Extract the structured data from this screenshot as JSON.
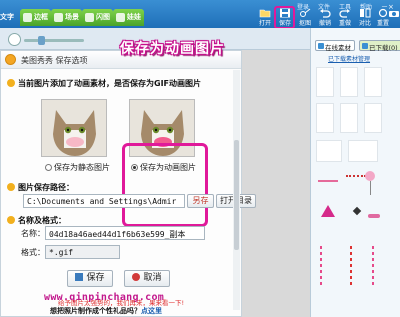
{
  "toolbar": {
    "left_fragment": "文字",
    "tabs": [
      {
        "label": "边框",
        "color": "#5bbd32"
      },
      {
        "label": "场景",
        "color": "#5bbd32"
      },
      {
        "label": "闪图",
        "color": "#5bbd32"
      },
      {
        "label": "娃娃",
        "color": "#5bbd32"
      }
    ],
    "menu": [
      "登录",
      "文件",
      "工具",
      "帮助"
    ],
    "buttons": [
      {
        "label": "打开",
        "icon": "folder-icon"
      },
      {
        "label": "保存",
        "icon": "save-icon"
      },
      {
        "label": "抠图",
        "icon": "cutout-icon"
      },
      {
        "label": "撤销",
        "icon": "undo-icon"
      },
      {
        "label": "重做",
        "icon": "redo-icon"
      },
      {
        "label": "对比",
        "icon": "compare-icon"
      },
      {
        "label": "重置",
        "icon": "reset-icon"
      },
      {
        "label": "修图",
        "icon": "camera-icon"
      }
    ]
  },
  "annotation": "保存为动画图片",
  "dialog": {
    "title": "美图秀秀  保存选项",
    "question": "当前图片添加了动画素材，是否保存为GIF动画图片",
    "options": [
      {
        "label": "保存为静态图片",
        "selected": false
      },
      {
        "label": "保存为动画图片",
        "selected": true
      }
    ],
    "path_section": "图片保存路径：",
    "path_value": "C:\\Documents and Settings\\Admir",
    "btn_save_as": "另存",
    "btn_open_dir": "打开目录",
    "name_section": "名称及格式：",
    "name_label": "名称：",
    "name_value": "04d18a46aed44d1f6b63e599_副本",
    "format_label": "格式：",
    "format_value": "*.gif",
    "btn_save": "保存",
    "btn_cancel": "取消"
  },
  "watermark": "www.qinpinchang.com",
  "red_tip": "给予图片太强势的，我们再来，果来看一下!",
  "bottom_tip": {
    "prefix": "想把照片制作成个性礼品吗？",
    "link": "点这里"
  },
  "right_panel": {
    "tab1": "在线素材",
    "tab2": "已下载(0)",
    "link": "已下载素材管理"
  },
  "colors": {
    "accent_magenta": "#e0199a",
    "toolbar_blue": "#2a7fc8",
    "tab_green": "#5bbd32"
  }
}
